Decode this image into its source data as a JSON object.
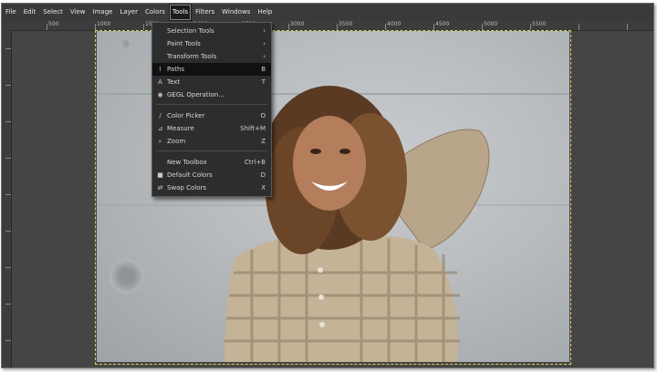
{
  "menubar": {
    "items": [
      "File",
      "Edit",
      "Select",
      "View",
      "Image",
      "Layer",
      "Colors",
      "Tools",
      "Filters",
      "Windows",
      "Help"
    ],
    "active": "Tools"
  },
  "ruler": {
    "top_labels": [
      "500",
      "1000",
      "1500",
      "2000",
      "2500",
      "3000",
      "3500",
      "4000",
      "4500",
      "5000",
      "5500"
    ]
  },
  "tools_menu": {
    "items": [
      {
        "label": "Selection Tools",
        "shortcut": "",
        "icon": "",
        "submenu": true
      },
      {
        "label": "Paint Tools",
        "shortcut": "",
        "icon": "",
        "submenu": true
      },
      {
        "label": "Transform Tools",
        "shortcut": "",
        "icon": "",
        "submenu": true
      },
      {
        "label": "Paths",
        "shortcut": "B",
        "icon": "paths-icon",
        "highlighted": true
      },
      {
        "label": "Text",
        "shortcut": "T",
        "icon": "text-icon"
      },
      {
        "label": "GEGL Operation...",
        "shortcut": "",
        "icon": "gegl-icon"
      },
      {
        "label": "Color Picker",
        "shortcut": "O",
        "icon": "color-picker-icon"
      },
      {
        "label": "Measure",
        "shortcut": "Shift+M",
        "icon": "measure-icon"
      },
      {
        "label": "Zoom",
        "shortcut": "Z",
        "icon": "zoom-icon"
      },
      {
        "label": "New Toolbox",
        "shortcut": "Ctrl+B",
        "icon": ""
      },
      {
        "label": "Default Colors",
        "shortcut": "D",
        "icon": "default-colors-icon"
      },
      {
        "label": "Swap Colors",
        "shortcut": "X",
        "icon": "swap-colors-icon"
      }
    ],
    "submenu_arrow": "›",
    "icon_glyphs": {
      "paths-icon": "⌇",
      "text-icon": "A",
      "gegl-icon": "◉",
      "color-picker-icon": "∕",
      "measure-icon": "⊿",
      "zoom-icon": "⌕",
      "default-colors-icon": "■",
      "swap-colors-icon": "⇄"
    }
  },
  "colors": {
    "menubar_bg": "#3a3a3a",
    "workspace_bg": "#454545",
    "menu_bg": "#2d2d2d",
    "menu_highlight": "#111111",
    "canvas_border": "#d6d45e"
  }
}
